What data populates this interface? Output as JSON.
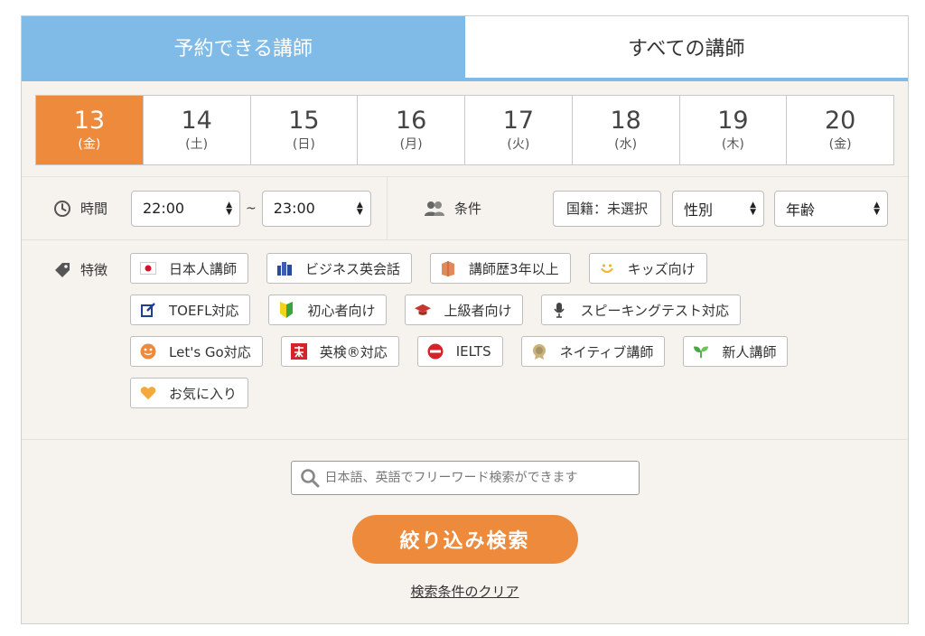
{
  "tabs": [
    {
      "label": "予約できる講師",
      "active": true
    },
    {
      "label": "すべての講師",
      "active": false
    }
  ],
  "dates": [
    {
      "day": "13",
      "weekday": "(金)",
      "selected": true
    },
    {
      "day": "14",
      "weekday": "(土)"
    },
    {
      "day": "15",
      "weekday": "(日)"
    },
    {
      "day": "16",
      "weekday": "(月)"
    },
    {
      "day": "17",
      "weekday": "(火)"
    },
    {
      "day": "18",
      "weekday": "(水)"
    },
    {
      "day": "19",
      "weekday": "(木)"
    },
    {
      "day": "20",
      "weekday": "(金)"
    }
  ],
  "time": {
    "label": "時間",
    "from": "22:00",
    "separator": "~",
    "to": "23:00"
  },
  "conditions": {
    "label": "条件",
    "nationality": "国籍：未選択",
    "gender": "性別",
    "age": "年齢"
  },
  "features": {
    "label": "特徴",
    "chips": [
      {
        "label": "日本人講師",
        "icon": "japan-flag-icon"
      },
      {
        "label": "ビジネス英会話",
        "icon": "buildings-icon"
      },
      {
        "label": "講師歴3年以上",
        "icon": "book-icon"
      },
      {
        "label": "キッズ向け",
        "icon": "smile-icon"
      },
      {
        "label": "TOEFL対応",
        "icon": "edit-icon"
      },
      {
        "label": "初心者向け",
        "icon": "beginner-mark-icon"
      },
      {
        "label": "上級者向け",
        "icon": "graduation-cap-icon"
      },
      {
        "label": "スピーキングテスト対応",
        "icon": "microphone-icon"
      },
      {
        "label": "Let's Go対応",
        "icon": "letsgo-icon"
      },
      {
        "label": "英検®対応",
        "icon": "eiken-icon"
      },
      {
        "label": "IELTS",
        "icon": "ielts-icon"
      },
      {
        "label": "ネイティブ講師",
        "icon": "native-badge-icon"
      },
      {
        "label": "新人講師",
        "icon": "sprout-icon"
      },
      {
        "label": "お気に入り",
        "icon": "heart-icon"
      }
    ]
  },
  "search": {
    "placeholder": "日本語、英語でフリーワード検索ができます",
    "submit_label": "絞り込み検索",
    "clear_label": "検索条件のクリア"
  },
  "colors": {
    "tab_active": "#7fbbe6",
    "accent_orange": "#ee8a3c",
    "panel_bg": "#f6f3ef"
  }
}
